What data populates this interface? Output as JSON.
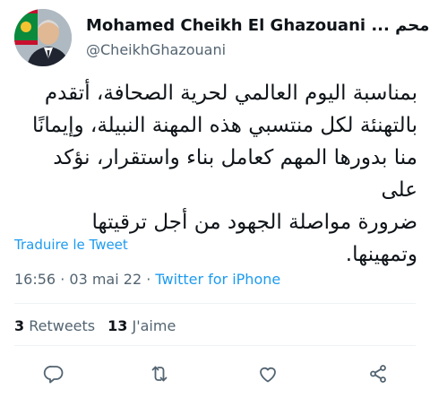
{
  "author": {
    "display_name": "Mohamed Cheikh El Ghazouani ... محم",
    "handle": "@CheikhGhazouani",
    "verified_icon": "verified-badge-icon",
    "avatar_icon": "avatar"
  },
  "tweet": {
    "text": "بمناسبة اليوم العالمي لحرية الصحافة، أتقدم\nبالتهنئة لكل منتسبي هذه المهنة النبيلة، وإيمانًا\nمنا  بدورها المهم كعامل بناء واستقرار، نؤكد على\nضرورة مواصلة الجهود من أجل ترقيتها\nوتمهينها.",
    "translate_label": "Traduire le Tweet",
    "time": "16:56",
    "date": "03 mai 22",
    "separator": "·",
    "source": "Twitter for iPhone"
  },
  "stats": {
    "retweets_count": "3",
    "retweets_label": "Retweets",
    "likes_count": "13",
    "likes_label": "J'aime"
  },
  "actions": [
    "reply-icon",
    "retweet-icon",
    "like-icon",
    "share-icon"
  ],
  "colors": {
    "accent": "#1d9bf0",
    "text": "#0f1419",
    "secondary": "#536471",
    "divider": "#eff3f4"
  }
}
